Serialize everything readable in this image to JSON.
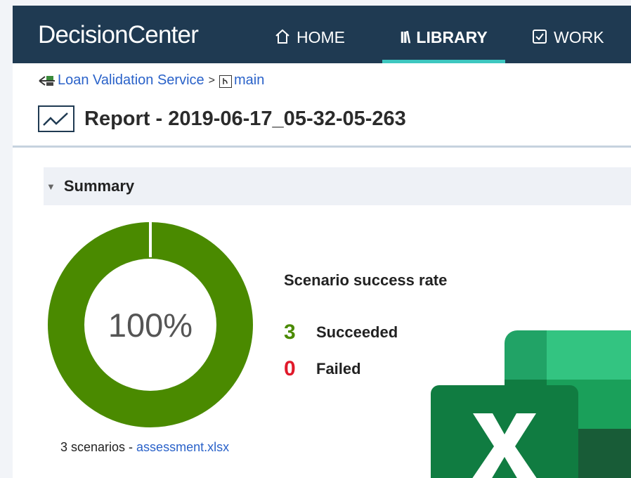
{
  "nav": {
    "brand": "DecisionCenter",
    "items": [
      {
        "label": "HOME",
        "icon": "home-icon"
      },
      {
        "label": "LIBRARY",
        "icon": "library-icon",
        "active": true
      },
      {
        "label": "WORK",
        "icon": "work-checkbox-icon"
      }
    ]
  },
  "breadcrumb": {
    "service": "Loan Validation Service",
    "separator": ">",
    "branch": "main"
  },
  "report": {
    "title": "Report - 2019-06-17_05-32-05-263"
  },
  "summary": {
    "heading": "Summary",
    "percent_text": "100%",
    "success_fraction": 1.0,
    "rate_title": "Scenario success rate",
    "succeeded_count": "3",
    "succeeded_label": "Succeeded",
    "failed_count": "0",
    "failed_label": "Failed",
    "scenarios_text": "3 scenarios - ",
    "file_name": "assessment.xlsx"
  },
  "colors": {
    "nav_bg": "#1f3a52",
    "active_underline": "#3ec7c0",
    "success": "#4a8a00",
    "failed": "#e0192a",
    "link": "#2a62c9"
  }
}
